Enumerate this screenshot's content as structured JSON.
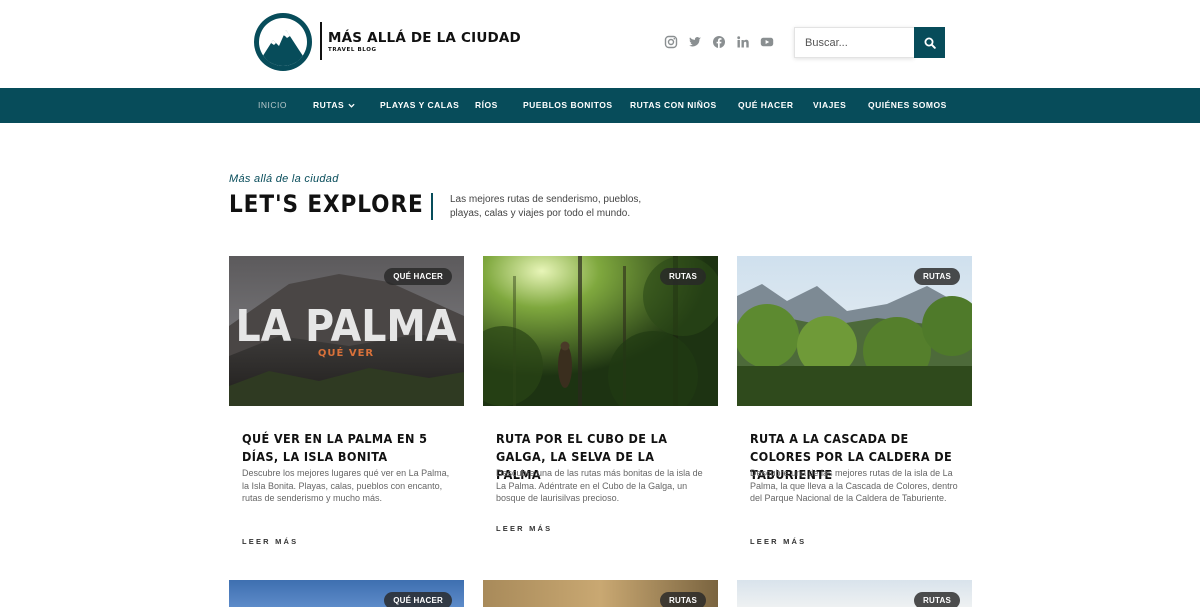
{
  "brand": {
    "title": "MÁS ALLÁ DE LA CIUDAD",
    "subtitle": "TRAVEL BLOG",
    "accent_color": "#074c5a"
  },
  "social": [
    "instagram-icon",
    "twitter-icon",
    "facebook-icon",
    "linkedin-icon",
    "youtube-icon"
  ],
  "search": {
    "placeholder": "Buscar..."
  },
  "nav": {
    "items": [
      {
        "label": "INICIO"
      },
      {
        "label": "RUTAS"
      },
      {
        "label": "PLAYAS Y CALAS"
      },
      {
        "label": "RÍOS"
      },
      {
        "label": "PUEBLOS BONITOS"
      },
      {
        "label": "RUTAS CON NIÑOS"
      },
      {
        "label": "QUÉ HACER"
      },
      {
        "label": "VIAJES"
      },
      {
        "label": "QUIÉNES SOMOS"
      }
    ]
  },
  "intro": {
    "eyebrow": "Más allá de la ciudad",
    "headline": "LET'S EXPLORE",
    "text": "Las mejores rutas de senderismo, pueblos, playas, calas y viajes por todo el mundo."
  },
  "cards": [
    {
      "badge": "QUÉ HACER",
      "image_title": "LA PALMA",
      "image_subtitle": "QUÉ VER",
      "title": "QUÉ VER EN LA PALMA EN 5 DÍAS, LA ISLA BONITA",
      "excerpt": "Descubre los mejores lugares qué ver en La Palma, la Isla Bonita. Playas, calas, pueblos con encanto, rutas de senderismo y mucho más.",
      "more": "LEER MÁS"
    },
    {
      "badge": "RUTAS",
      "title": "RUTA POR EL CUBO DE LA GALGA, LA SELVA DE LA PALMA",
      "excerpt": "Descubre una de las rutas más bonitas de la isla de La Palma. Adéntrate en el Cubo de la Galga, un bosque de laurisilvas precioso.",
      "more": "LEER MÁS"
    },
    {
      "badge": "RUTAS",
      "title": "RUTA A LA CASCADA DE COLORES POR LA CALDERA DE TABURIENTE",
      "excerpt": "Descubre una de las mejores rutas de la isla de La Palma, la que lleva a la Cascada de Colores, dentro del Parque Nacional de la Caldera de Taburiente.",
      "more": "LEER MÁS"
    }
  ],
  "next_row": [
    {
      "badge": "QUÉ HACER"
    },
    {
      "badge": "RUTAS"
    },
    {
      "badge": "RUTAS"
    }
  ]
}
